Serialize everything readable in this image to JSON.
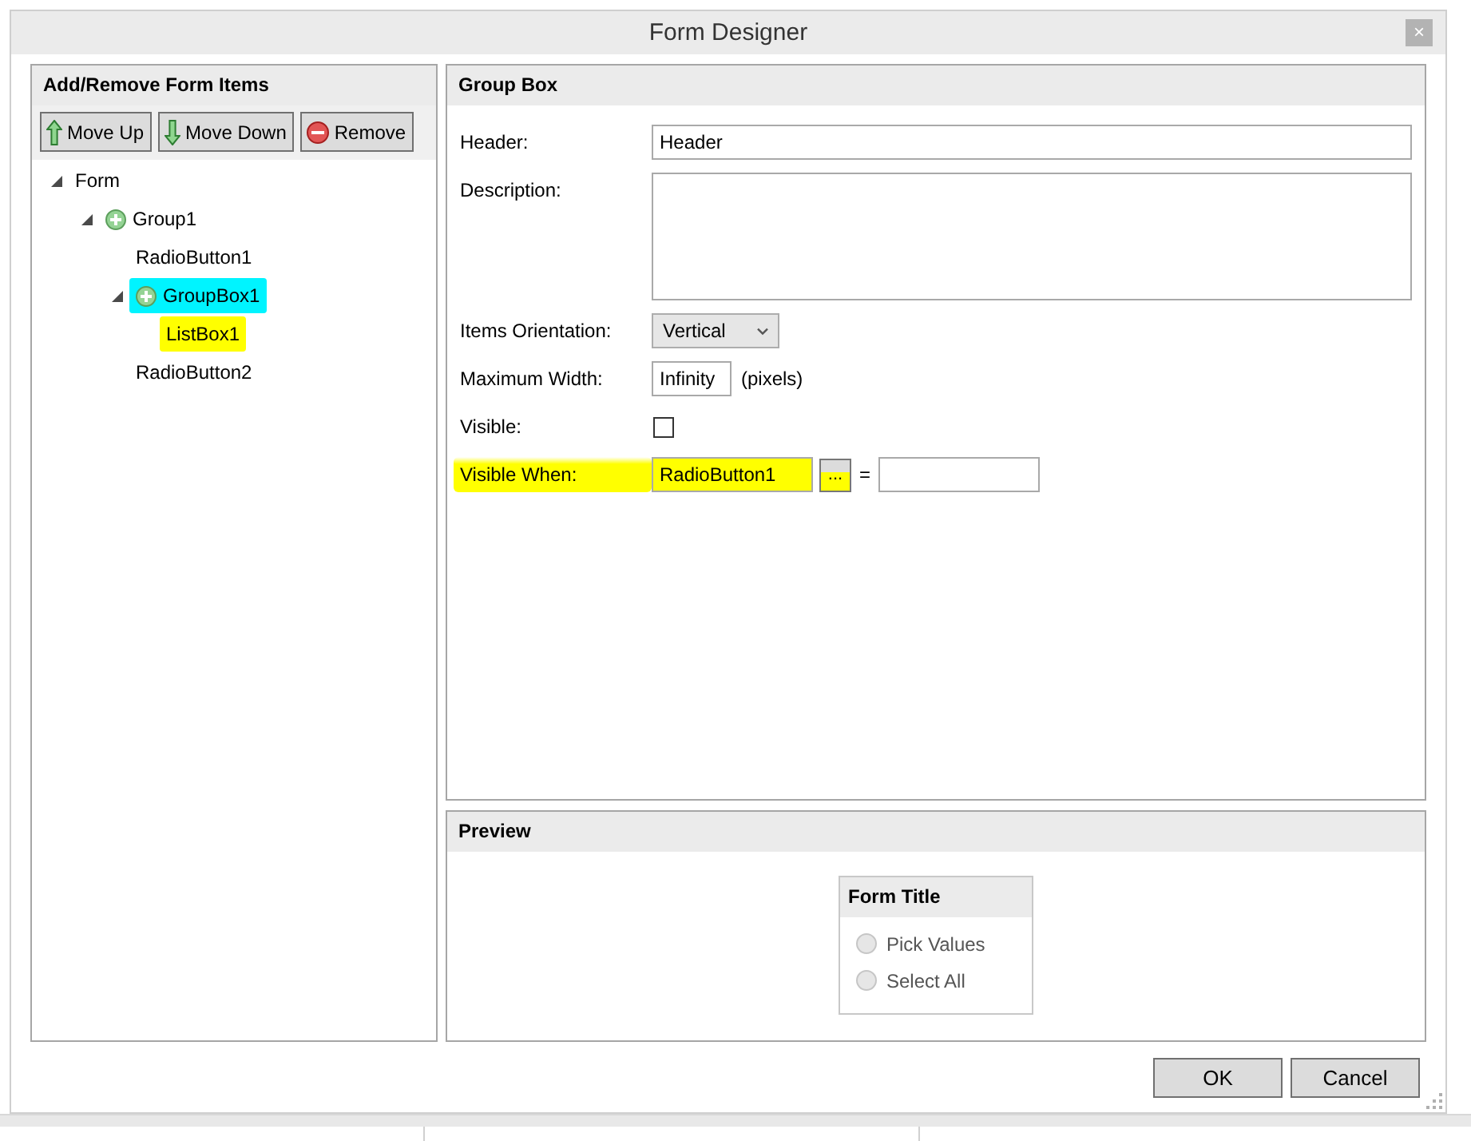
{
  "window": {
    "title": "Form Designer",
    "close_button": "×"
  },
  "items_panel": {
    "title": "Add/Remove Form Items",
    "buttons": [
      {
        "kind": "up",
        "label": "Move Up"
      },
      {
        "kind": "down",
        "label": "Move Down"
      },
      {
        "kind": "remove",
        "label": "Remove"
      }
    ],
    "tree": [
      {
        "label": "Form",
        "expanded": true,
        "selected": false,
        "highlighted": false,
        "children": [
          {
            "kind": "group",
            "label": "Group1",
            "expanded": true,
            "selected": false,
            "highlighted": false,
            "children": [
              {
                "label": "RadioButton1",
                "selected": false,
                "highlighted": false
              },
              {
                "kind": "group",
                "label": "GroupBox1",
                "expanded": true,
                "selected": true,
                "highlighted": false,
                "children": [
                  {
                    "label": "ListBox1",
                    "selected": false,
                    "highlighted": true
                  }
                ]
              },
              {
                "label": "RadioButton2",
                "selected": false,
                "highlighted": false
              }
            ]
          }
        ]
      }
    ]
  },
  "properties_panel": {
    "title": "Group Box",
    "fields": [
      {
        "kind": "text",
        "label": "Header:",
        "value": "Header",
        "highlighted": false
      },
      {
        "kind": "textarea",
        "label": "Description:",
        "highlighted": false
      },
      {
        "kind": "select",
        "label": "Items Orientation:",
        "value": "Vertical",
        "highlighted": false
      },
      {
        "kind": "number",
        "label": "Maximum Width:",
        "value": "Infinity",
        "unit": "(pixels)",
        "highlighted": false
      },
      {
        "kind": "checkbox",
        "label": "Visible:",
        "checked": false,
        "highlighted": false
      },
      {
        "kind": "condition",
        "label": "Visible When:",
        "value": "RadioButton1",
        "button": "...",
        "operator": "=",
        "highlighted": true
      }
    ]
  },
  "preview_panel": {
    "title": "Preview",
    "form": {
      "title": "Form Title",
      "options": [
        {
          "label": "Pick Values",
          "selected": false,
          "disabled": true
        },
        {
          "label": "Select All",
          "selected": false,
          "disabled": true
        }
      ]
    }
  },
  "buttons": [
    "OK",
    "Cancel"
  ]
}
